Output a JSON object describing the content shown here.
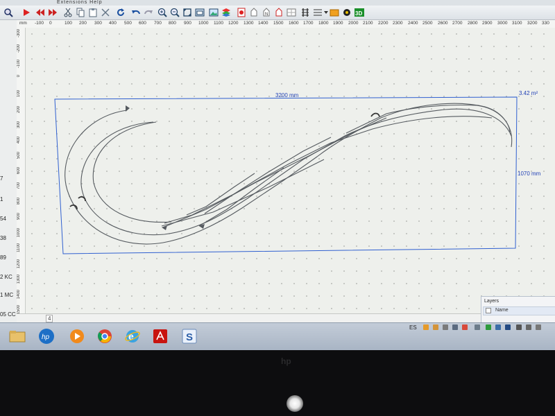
{
  "menubar": {
    "text": "Extensions    Help"
  },
  "ruler": {
    "h_ticks": [
      "mm",
      "-100",
      "0",
      "100",
      "200",
      "300",
      "400",
      "500",
      "600",
      "700",
      "800",
      "900",
      "1000",
      "1100",
      "1200",
      "1300",
      "1400",
      "1500",
      "1600",
      "1700",
      "1800",
      "1900",
      "2000",
      "2100",
      "2200",
      "2300",
      "2400",
      "2500",
      "2600",
      "2700",
      "2800",
      "2900",
      "3000",
      "3100",
      "3200",
      "330"
    ],
    "v_ticks": [
      "-300",
      "-200",
      "-100",
      "0",
      "100",
      "200",
      "300",
      "400",
      "500",
      "600",
      "700",
      "800",
      "900",
      "1000",
      "1100",
      "1200",
      "1300",
      "1400",
      "1500"
    ]
  },
  "left_strip": {
    "numbers": [
      "7",
      "1",
      "54",
      "38",
      "89",
      "2 KC",
      "1 MC",
      "05 CC"
    ]
  },
  "board": {
    "width_label": "3200 mm",
    "height_label": "1070 mm",
    "area_label": "3.42 m²"
  },
  "statusbar": {
    "page": "4"
  },
  "layers": {
    "title": "Layers",
    "column": "Name"
  },
  "tray": {
    "language": "ES"
  },
  "taskbar": {
    "apps": [
      "file-explorer",
      "hp",
      "media-player",
      "chrome",
      "internet-explorer",
      "acrobat",
      "skype"
    ]
  },
  "bezel": {
    "logo": "hp"
  },
  "colors": {
    "board_outline": "#2f5fd0",
    "dimension_text": "#1f3fb5",
    "track": "#555a5f"
  }
}
